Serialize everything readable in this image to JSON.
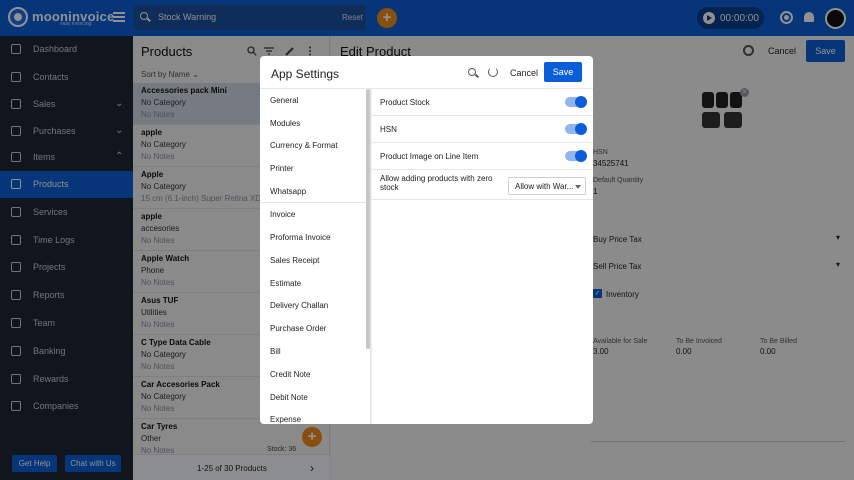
{
  "app": {
    "brand": "mooninvoice",
    "brand_sub": "easy invoicing"
  },
  "topbar": {
    "search_value": "Stock Warning",
    "reset_label": "Reset",
    "timer": "00:00:00"
  },
  "sidebar": {
    "items": [
      {
        "label": "Dashboard",
        "icon": "home-icon"
      },
      {
        "label": "Contacts",
        "icon": "contacts-icon"
      },
      {
        "label": "Sales",
        "icon": "sales-icon",
        "chevron": "⌄"
      },
      {
        "label": "Purchases",
        "icon": "purchases-icon",
        "chevron": "⌄"
      },
      {
        "label": "Items",
        "icon": "items-icon",
        "chevron": "⌃"
      },
      {
        "label": "Products",
        "icon": "box-icon"
      },
      {
        "label": "Services",
        "icon": "services-icon"
      },
      {
        "label": "Time Logs",
        "icon": "clock-icon"
      },
      {
        "label": "Projects",
        "icon": "projects-icon"
      },
      {
        "label": "Reports",
        "icon": "reports-icon"
      },
      {
        "label": "Team",
        "icon": "team-icon"
      },
      {
        "label": "Banking",
        "icon": "bank-icon"
      },
      {
        "label": "Rewards",
        "icon": "rewards-icon"
      },
      {
        "label": "Companies",
        "icon": "companies-icon"
      }
    ],
    "help_label": "Get Help",
    "chat_label": "Chat with Us"
  },
  "products": {
    "title": "Products",
    "sort_label": "Sort by Name",
    "rows": [
      {
        "name": "Accessories pack Mini",
        "category": "No Category",
        "notes": "No Notes"
      },
      {
        "name": "apple",
        "category": "No Category",
        "notes": "No Notes"
      },
      {
        "name": "Apple",
        "category": "No Category",
        "notes": "15 cm (6.1-inch) Super Retina XDR d"
      },
      {
        "name": "apple",
        "category": "accesories",
        "notes": "No Notes"
      },
      {
        "name": "Apple Watch",
        "category": "Phone",
        "notes": "No Notes"
      },
      {
        "name": "Asus TUF",
        "category": "Utilities",
        "notes": "No Notes"
      },
      {
        "name": "C Type Data Cable",
        "category": "No Category",
        "notes": "No Notes"
      },
      {
        "name": "Car Accesories Pack",
        "category": "No Category",
        "notes": "No Notes"
      },
      {
        "name": "Car Tyres",
        "category": "Other",
        "notes": "No Notes",
        "stock": "Stock: 36"
      }
    ],
    "pager": "1-25 of 30 Products"
  },
  "edit": {
    "title": "Edit Product",
    "cancel_label": "Cancel",
    "save_label": "Save",
    "hsn_label": "HSN",
    "hsn_value": "34525741",
    "default_qty_label": "Default Quantity",
    "default_qty_value": "1",
    "buy_tax_label": "Buy Price Tax",
    "sell_tax_label": "Sell Price Tax",
    "inventory_label": "Inventory",
    "available_label": "Available for Sale",
    "available_value": "3.00",
    "to_be_invoiced_label": "To Be Invoiced",
    "to_be_invoiced_value": "0.00",
    "to_be_billed_label": "To Be Billed",
    "to_be_billed_value": "0.00"
  },
  "modal": {
    "title": "App Settings",
    "cancel_label": "Cancel",
    "save_label": "Save",
    "groups": [
      [
        "General",
        "Modules",
        "Currency & Format",
        "Printer",
        "Whatsapp"
      ],
      [
        "Invoice",
        "Proforma Invoice",
        "Sales Receipt",
        "Estimate",
        "Delivery Challan",
        "Purchase Order",
        "Bill",
        "Credit Note",
        "Debit Note",
        "Expense"
      ]
    ],
    "settings": [
      {
        "label": "Product Stock",
        "type": "toggle",
        "on": true
      },
      {
        "label": "HSN",
        "type": "toggle",
        "on": true
      },
      {
        "label": "Product Image on Line Item",
        "type": "toggle",
        "on": true
      },
      {
        "label": "Allow adding products with zero stock",
        "type": "select",
        "value": "Allow with War..."
      }
    ]
  },
  "colors": {
    "primary": "#0b5ed7",
    "accent": "#f08c1a",
    "sidebar": "#1f2535"
  }
}
